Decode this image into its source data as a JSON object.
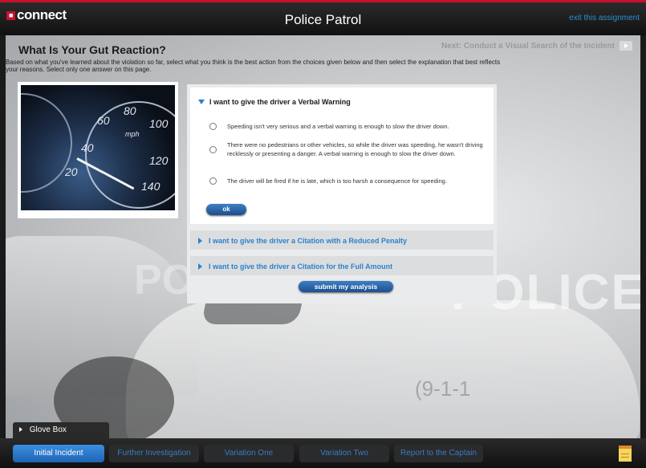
{
  "header": {
    "logo": "connect",
    "title": "Police Patrol",
    "exit_label": "exit this assignment"
  },
  "page": {
    "heading": "What Is Your Gut Reaction?",
    "next_label": "Next: Conduct a Visual Search of the Incident",
    "instructions": "Based on what you've learned about the violation so far, select what you think is the best action from the choices given below and then select the explanation that best reflects your reasons. Select only one answer on this page."
  },
  "photo": {
    "numbers": [
      "40",
      "60",
      "80",
      "100",
      "120",
      "140",
      "20"
    ],
    "label": "mph"
  },
  "options_panel": {
    "sections": [
      {
        "title": "I want to give the driver a Verbal Warning",
        "expanded": true,
        "choices": [
          "Speeding isn't very serious and a verbal warning is enough to slow the driver down.",
          "There were no pedestrians or other vehicles, so while the driver was speeding, he wasn't driving recklessly or presenting a danger. A verbal warning is enough to slow the driver down.",
          "The driver will be fired if he is late, which is too harsh a consequence for speeding."
        ],
        "ok_label": "ok"
      },
      {
        "title": "I want to give the driver a Citation with a Reduced Penalty",
        "expanded": false
      },
      {
        "title": "I want to give the driver a Citation for the Full Amount",
        "expanded": false
      }
    ],
    "submit_label": "submit my analysis"
  },
  "background": {
    "police_text": "POLICE",
    "police_text2": "POLIC",
    "unit_number": "(9-1-1"
  },
  "glove_box": {
    "label": "Glove Box"
  },
  "tabs": [
    {
      "label": "Initial Incident",
      "active": true
    },
    {
      "label": "Further Investigation",
      "active": false
    },
    {
      "label": "Variation One",
      "active": false
    },
    {
      "label": "Variation Two",
      "active": false
    },
    {
      "label": "Report to the Captain",
      "active": false
    }
  ],
  "icons": {
    "logo_mark": "connect-logo-icon",
    "next": "play-arrow-icon",
    "notepad": "notepad-icon"
  },
  "colors": {
    "brand_red": "#c8102e",
    "link_blue": "#2c82c9",
    "active_tab": "#2f7fd0"
  }
}
